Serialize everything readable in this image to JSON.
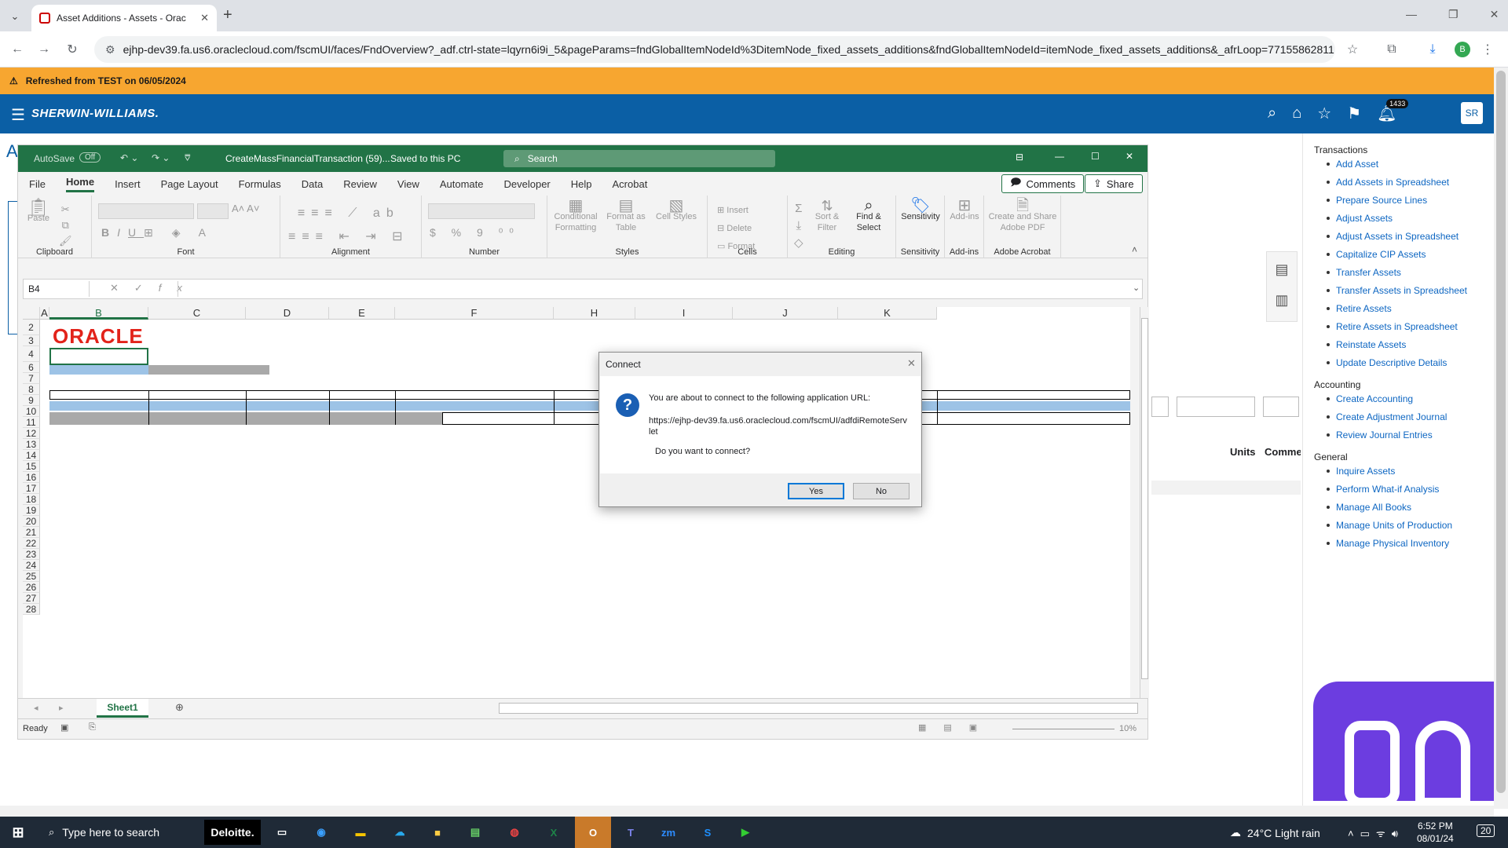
{
  "browser": {
    "tab_title": "Asset Additions - Assets - Orac",
    "url": "ejhp-dev39.fa.us6.oraclecloud.com/fscmUI/faces/FndOverview?_adf.ctrl-state=lqyrn6i9i_5&pageParams=fndGlobalItemNodeId%3DitemNode_fixed_assets_additions&fndGlobalItemNodeId=itemNode_fixed_assets_additions&_afrLoop=77155862811...",
    "profile_initial": "B"
  },
  "banner": {
    "text": "Refreshed from TEST on 06/05/2024"
  },
  "header": {
    "brand": "SHERWIN-WILLIAMS.",
    "notif_count": "1433",
    "user_initials": "SR"
  },
  "page": {
    "title_fragment": "A",
    "units_label": "Units",
    "comments_label": "Comme"
  },
  "tasks": {
    "transactions_title": "Transactions",
    "transactions": [
      "Add Asset",
      "Add Assets in Spreadsheet",
      "Prepare Source Lines",
      "Adjust Assets",
      "Adjust Assets in Spreadsheet",
      "Capitalize CIP Assets",
      "Transfer Assets",
      "Transfer Assets in Spreadsheet",
      "Retire Assets",
      "Retire Assets in Spreadsheet",
      "Reinstate Assets",
      "Update Descriptive Details"
    ],
    "accounting_title": "Accounting",
    "accounting": [
      "Create Accounting",
      "Create Adjustment Journal",
      "Review Journal Entries"
    ],
    "general_title": "General",
    "general": [
      "Inquire Assets",
      "Perform What-if Analysis",
      "Manage All Books",
      "Manage Units of Production",
      "Manage Physical Inventory"
    ]
  },
  "excel": {
    "autosave": "AutoSave",
    "autosave_state": "Off",
    "filename": "CreateMassFinancialTransaction (59)...",
    "saved": "Saved to this PC",
    "search": "Search",
    "tabs": [
      "File",
      "Home",
      "Insert",
      "Page Layout",
      "Formulas",
      "Data",
      "Review",
      "View",
      "Automate",
      "Developer",
      "Help",
      "Acrobat"
    ],
    "comments": "Comments",
    "share": "Share",
    "groups": {
      "clipboard": "Clipboard",
      "font": "Font",
      "alignment": "Alignment",
      "number": "Number",
      "styles": "Styles",
      "cells": "Cells",
      "editing": "Editing",
      "sensitivity": "Sensitivity",
      "addins": "Add-ins",
      "adobe": "Adobe Acrobat"
    },
    "buttons": {
      "paste": "Paste",
      "cond_fmt": "Conditional Formatting",
      "fmt_table": "Format as Table",
      "cell_styles": "Cell Styles",
      "insert": "Insert",
      "delete": "Delete",
      "format": "Format",
      "sort": "Sort & Filter",
      "find": "Find & Select",
      "sensitivity": "Sensitivity",
      "addins": "Add-ins",
      "create_pdf": "Create and Share Adobe PDF"
    },
    "namebox": "B4",
    "columns": [
      "A",
      "B",
      "C",
      "D",
      "E",
      "F",
      "H",
      "I",
      "J",
      "K"
    ],
    "rows": [
      "2",
      "3",
      "4",
      "6",
      "7",
      "8",
      "9",
      "10",
      "11",
      "12",
      "13",
      "14",
      "15",
      "16",
      "17",
      "18",
      "19",
      "20",
      "21",
      "22",
      "23",
      "24",
      "25",
      "26",
      "27",
      "28"
    ],
    "logo": "ORACLE",
    "sheet": "Sheet1",
    "status": "Ready",
    "zoom": "10%"
  },
  "dialog": {
    "title": "Connect",
    "message": "You are about to connect to the following application URL:",
    "url": "https://ejhp-dev39.fa.us6.oraclecloud.com/fscmUI/adfdiRemoteServlet",
    "question": "Do you want to connect?",
    "yes": "Yes",
    "no": "No"
  },
  "taskbar": {
    "search": "Type here to search",
    "deloitte": "Deloitte.",
    "weather": "24°C  Light rain",
    "time": "6:52 PM",
    "date": "08/01/24",
    "notif": "20"
  }
}
